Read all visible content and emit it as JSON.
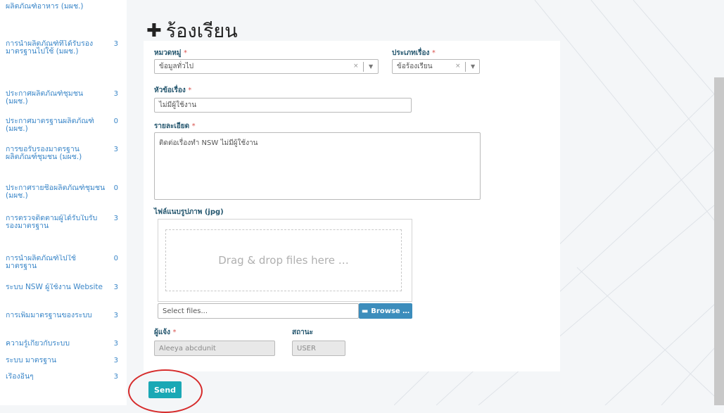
{
  "sidebar": {
    "items": [
      {
        "label": "ผลิตภัณฑ์อาหาร (มผช.)",
        "count": ""
      },
      {
        "label": "การนำผลิตภัณฑ์ที่ได้รับรองมาตรฐานไปใช้ (มผช.)",
        "count": "3"
      },
      {
        "label": "ประกาศผลิตภัณฑ์ชุมชน (มผช.)",
        "count": "3"
      },
      {
        "label": "ประกาศมาตรฐานผลิตภัณฑ์ (มผช.)",
        "count": "0"
      },
      {
        "label": "การขอรับรองมาตรฐานผลิตภัณฑ์ชุมชน (มผช.)",
        "count": "3"
      },
      {
        "label": "ประกาศรายชื่อผลิตภัณฑ์ชุมชน (มผช.)",
        "count": "0"
      },
      {
        "label": "การตรวจติดตามผู้ได้รับใบรับรองมาตรฐาน",
        "count": "3"
      },
      {
        "label": "การนำผลิตภัณฑ์ไปใช้มาตรฐาน",
        "count": "0"
      },
      {
        "label": "ระบบ NSW ผู้ใช้งาน Website",
        "count": "3"
      },
      {
        "label": "การเพิ่มมาตรฐานของระบบ",
        "count": "3"
      },
      {
        "label": "ความรู้เกี่ยวกับระบบ",
        "count": "3"
      },
      {
        "label": "ระบบ มาตรฐาน",
        "count": "3"
      },
      {
        "label": "เรื่องอื่นๆ",
        "count": "3"
      }
    ]
  },
  "page": {
    "title": "ร้องเรียน",
    "title_icon": "plus-icon"
  },
  "form": {
    "category": {
      "label": "หมวดหมู่",
      "value": "ข้อมูลทั่วไป"
    },
    "type": {
      "label": "ประเภทเรื่อง",
      "value": "ข้อร้องเรียน"
    },
    "subject": {
      "label": "หัวข้อเรื่อง",
      "value": "ไม่มีผู้ใช้งาน"
    },
    "detail": {
      "label": "รายละเอียด",
      "value": "ติดต่อเรื่องทำ NSW ไม่มีผู้ใช้งาน"
    },
    "attachment": {
      "label": "ไฟล์แนบรูปภาพ (jpg)",
      "dropzone_text": "Drag & drop files here …",
      "select_placeholder": "Select files...",
      "browse_label": "Browse …",
      "browse_icon": "folder-icon"
    },
    "reporter": {
      "label": "ผู้แจ้ง",
      "value": "Aleeya abcdunit"
    },
    "status": {
      "label": "สถานะ",
      "value": "USER"
    },
    "required_mark": "*"
  },
  "actions": {
    "send_label": "Send"
  },
  "colors": {
    "accent": "#1aa8b5",
    "browse": "#3c8dbc",
    "label": "#24566e",
    "highlight": "#d62b2b"
  }
}
